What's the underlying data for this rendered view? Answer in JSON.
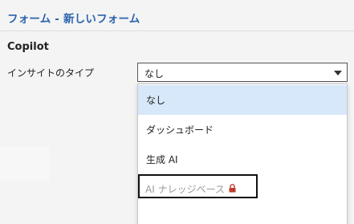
{
  "header": {
    "title": "フォーム - 新しいフォーム"
  },
  "section": {
    "title": "Copilot"
  },
  "insight_field": {
    "label": "インサイトのタイプ",
    "selected_value": "なし"
  },
  "dropdown": {
    "options": [
      {
        "label": "なし",
        "state": "highlighted"
      },
      {
        "label": "ダッシュボード",
        "state": "normal"
      },
      {
        "label": "生成 AI",
        "state": "normal"
      },
      {
        "label": "AI ナレッジベース",
        "state": "disabled",
        "icon": "lock-icon"
      }
    ]
  },
  "colors": {
    "title": "#2a63ad",
    "highlight_bg": "#d6e8f9",
    "lock": "#c0392b",
    "disabled_text": "#9a9a9a"
  }
}
